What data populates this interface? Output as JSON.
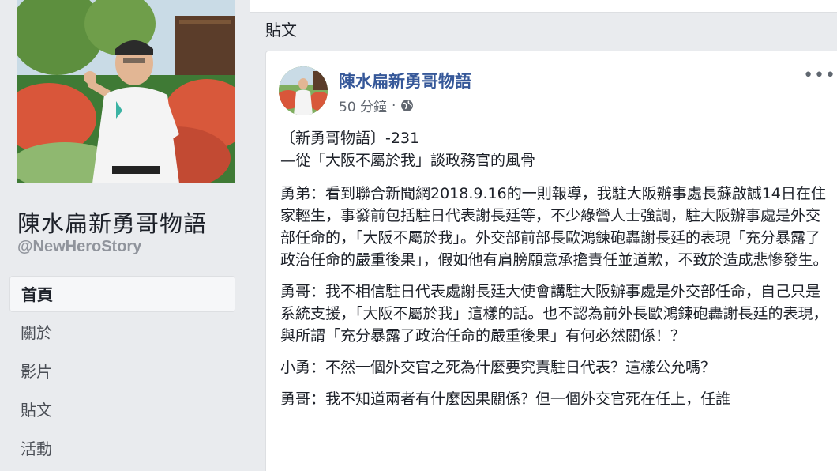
{
  "page": {
    "name": "陳水扁新勇哥物語",
    "handle": "@NewHeroStory"
  },
  "nav": {
    "items": [
      {
        "label": "首頁",
        "active": true
      },
      {
        "label": "關於",
        "active": false
      },
      {
        "label": "影片",
        "active": false
      },
      {
        "label": "貼文",
        "active": false
      },
      {
        "label": "活動",
        "active": false
      }
    ]
  },
  "section": {
    "title": "貼文"
  },
  "post": {
    "author": "陳水扁新勇哥物語",
    "time": "50 分鐘",
    "privacy_icon": "globe-icon",
    "more_label": "•••",
    "headline_1": "〔新勇哥物語〕-231",
    "headline_2": "—從「大阪不屬於我」談政務官的風骨",
    "paragraphs": [
      "勇弟：看到聯合新聞網2018.9.16的一則報導，我駐大阪辦事處長蘇啟誠14日在住家輕生，事發前包括駐日代表謝長廷等，不少綠營人士強調，駐大阪辦事處是外交部任命的，「大阪不屬於我」。外交部前部長歐鴻鍊砲轟謝長廷的表現「充分暴露了政治任命的嚴重後果」，假如他有肩膀願意承擔責任並道歉，不致於造成悲慘發生。",
      "勇哥：我不相信駐日代表處謝長廷大使會講駐大阪辦事處是外交部任命，自己只是系統支援，「大阪不屬於我」這樣的話。也不認為前外長歐鴻鍊砲轟謝長廷的表現，與所謂「充分暴露了政治任命的嚴重後果」有何必然關係！？",
      "小勇：不然一個外交官之死為什麼要究責駐日代表？這樣公允嗎？",
      "勇哥：我不知道兩者有什麼因果關係？但一個外交官死在任上，任誰"
    ]
  },
  "colors": {
    "link": "#365899",
    "background": "#e9ebee"
  }
}
